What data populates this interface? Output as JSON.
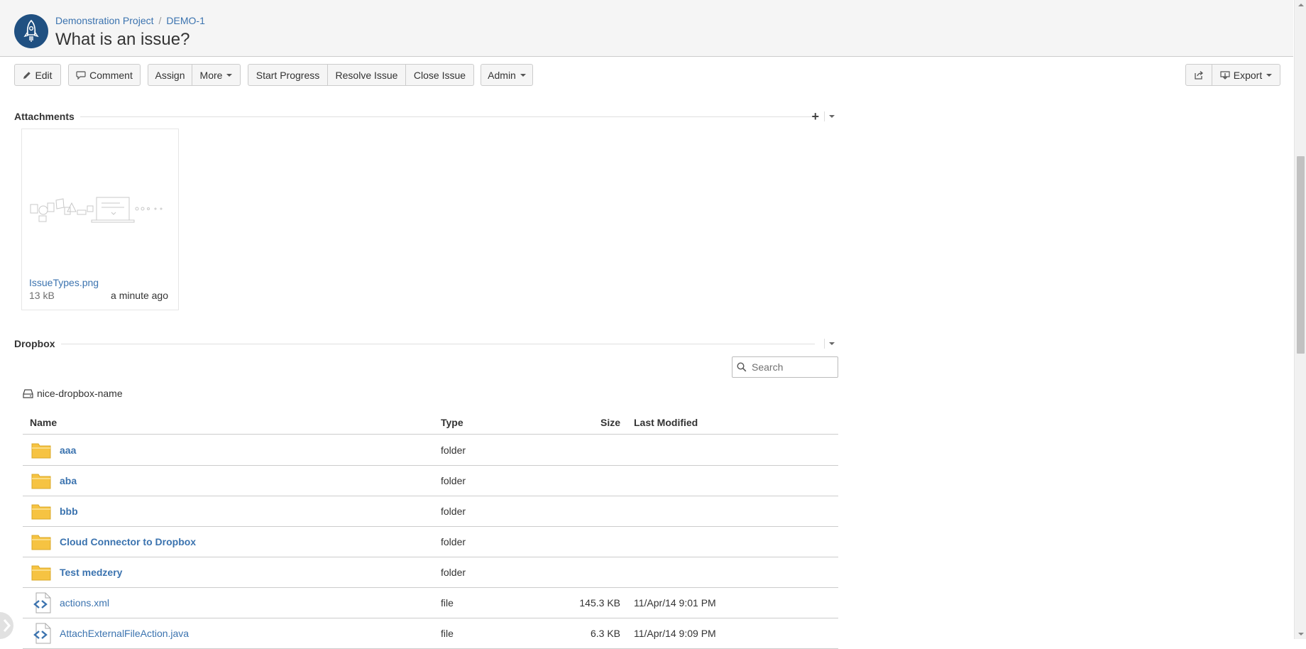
{
  "header": {
    "breadcrumb": {
      "project": "Demonstration Project",
      "separator": "/",
      "issue_key": "DEMO-1"
    },
    "title": "What is an issue?"
  },
  "toolbar": {
    "edit": "Edit",
    "comment": "Comment",
    "assign": "Assign",
    "more": "More",
    "start_progress": "Start Progress",
    "resolve_issue": "Resolve Issue",
    "close_issue": "Close Issue",
    "admin": "Admin",
    "export": "Export"
  },
  "attachments": {
    "heading": "Attachments",
    "items": [
      {
        "name": "IssueTypes.png",
        "size": "13 kB",
        "time": "a minute ago"
      }
    ]
  },
  "dropbox": {
    "heading": "Dropbox",
    "search": {
      "placeholder": "Search",
      "value": ""
    },
    "root_name": "nice-dropbox-name",
    "columns": {
      "name": "Name",
      "type": "Type",
      "size": "Size",
      "last_modified": "Last Modified"
    },
    "rows": [
      {
        "name": "aaa",
        "type": "folder",
        "size": "",
        "last_modified": ""
      },
      {
        "name": "aba",
        "type": "folder",
        "size": "",
        "last_modified": ""
      },
      {
        "name": "bbb",
        "type": "folder",
        "size": "",
        "last_modified": ""
      },
      {
        "name": "Cloud Connector to Dropbox",
        "type": "folder",
        "size": "",
        "last_modified": ""
      },
      {
        "name": "Test medzery",
        "type": "folder",
        "size": "",
        "last_modified": ""
      },
      {
        "name": "actions.xml",
        "type": "file",
        "size": "145.3 KB",
        "last_modified": "11/Apr/14 9:01 PM"
      },
      {
        "name": "AttachExternalFileAction.java",
        "type": "file",
        "size": "6.3 KB",
        "last_modified": "11/Apr/14 9:09 PM"
      }
    ]
  },
  "colors": {
    "link": "#3b73af",
    "avatar": "#205081",
    "folder": "#f6c342"
  }
}
